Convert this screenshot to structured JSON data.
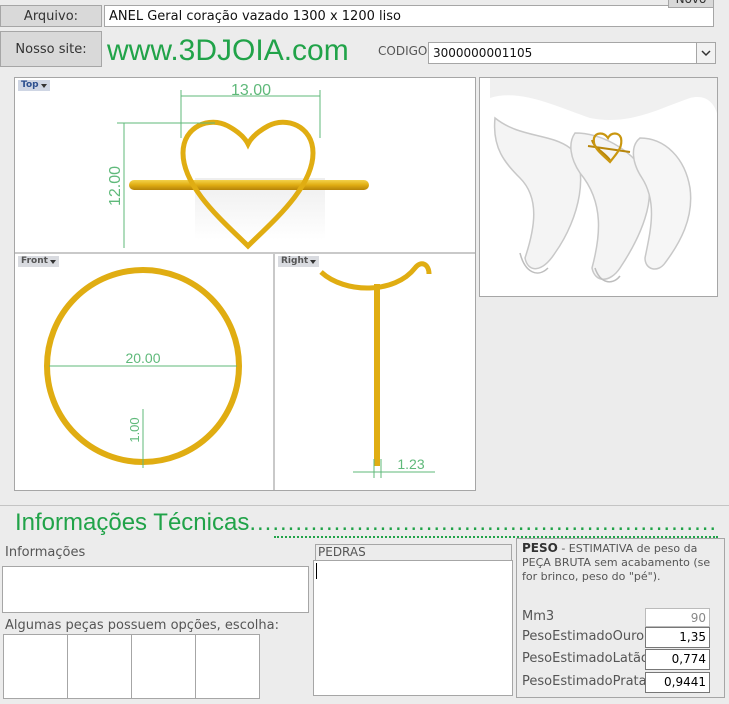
{
  "header": {
    "arquivo_label": "Arquivo:",
    "arquivo_value": "ANEL Geral coração vazado 1300 x 1200 liso",
    "novo_label": "Novo",
    "site_label": "Nosso site:",
    "site_url": "www.3DJOIA.com",
    "codigo_label": "CODIGO",
    "codigo_value": "3000000001105"
  },
  "views": {
    "top_label": "Top",
    "front_label": "Front",
    "right_label": "Right",
    "dim_width": "13.00",
    "dim_height": "12.00",
    "dim_diameter": "20.00",
    "dim_thickness": "1.00",
    "dim_side": "1.23"
  },
  "info": {
    "section_title": "Informações Técnicas",
    "informacoes_label": "Informações",
    "options_label": "Algumas peças possuem opções, escolha:",
    "pedras_label": "PEDRAS",
    "peso_title": "PESO",
    "peso_desc": " -  ESTIMATIVA de peso da PEÇA BRUTA sem acabamento (se for brinco, peso do \"pé\").",
    "rows": [
      {
        "label": "Mm3",
        "value": "90"
      },
      {
        "label": "PesoEstimadoOuro",
        "value": "1,35"
      },
      {
        "label": "PesoEstimadoLatão",
        "value": "0,774"
      },
      {
        "label": "PesoEstimadoPrata",
        "value": "0,9441"
      }
    ]
  },
  "colors": {
    "accent_green": "#21a349",
    "gold": "#e8b91a",
    "dimension_green": "#5fb97a"
  }
}
